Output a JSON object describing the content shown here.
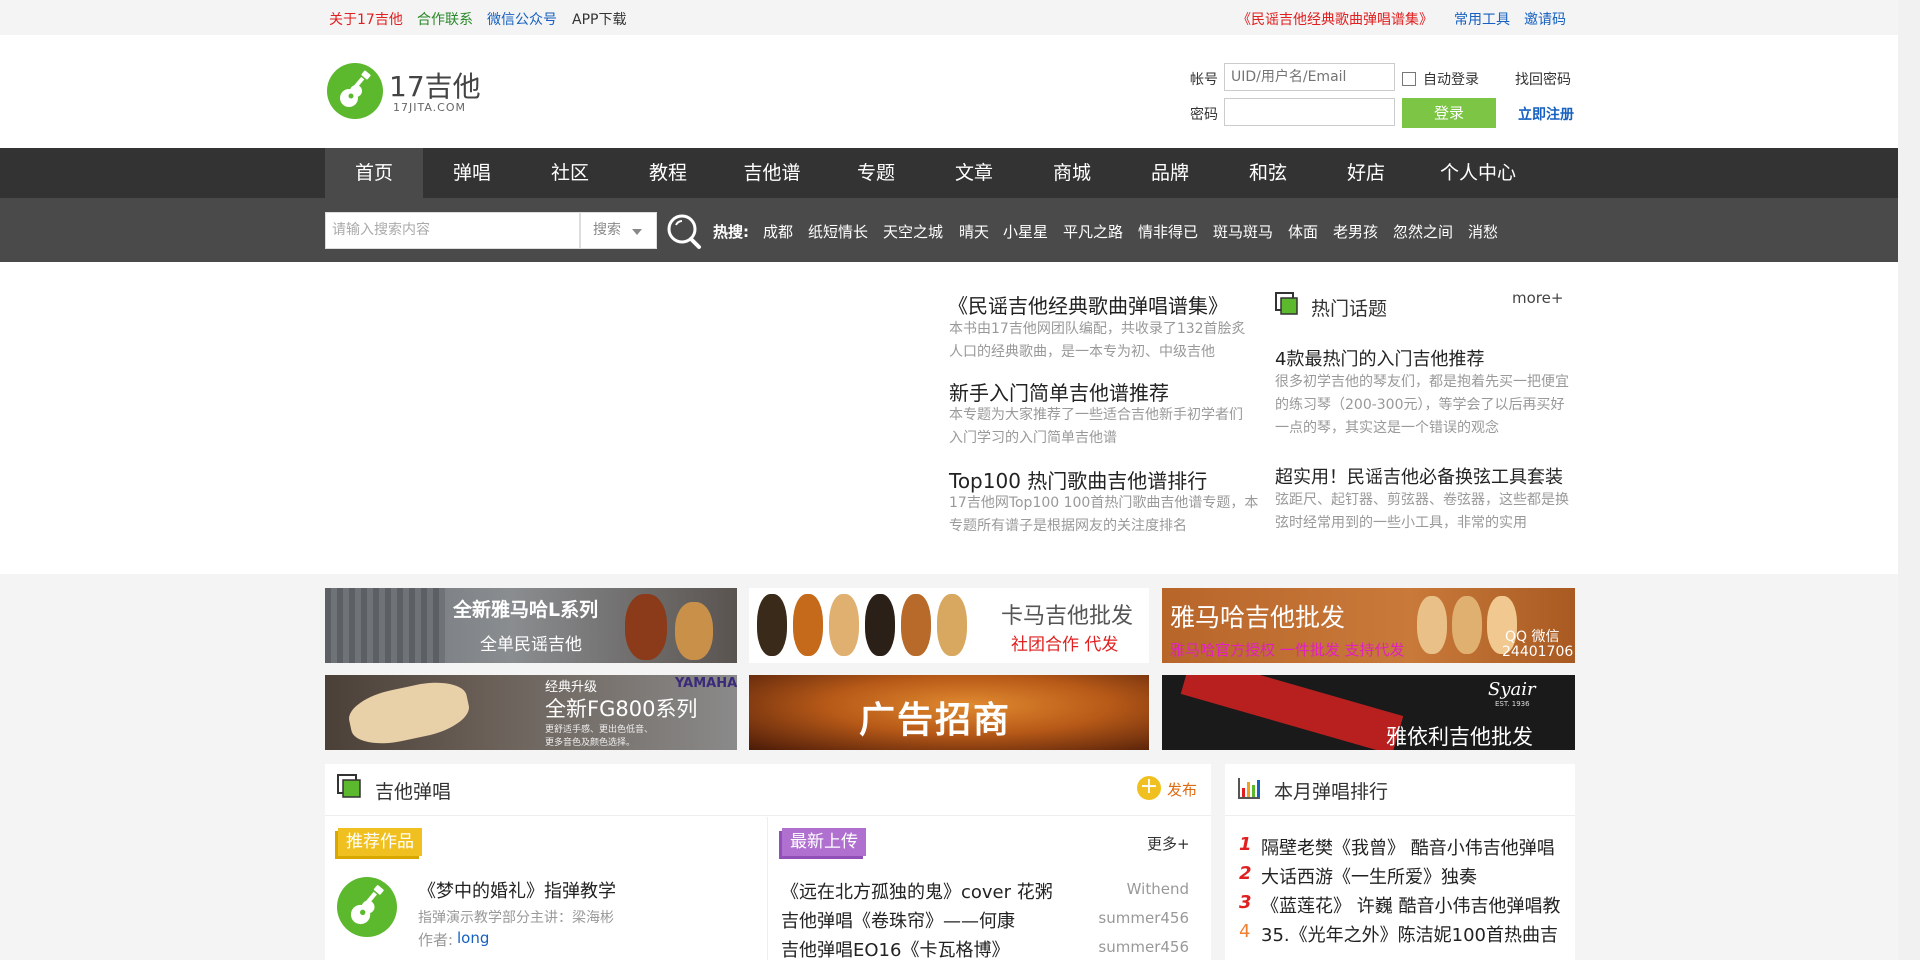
{
  "topbar": {
    "about": "关于17吉他",
    "contact": "合作联系",
    "wechat": "微信公众号",
    "app": "APP下载",
    "book": "《民谣吉他经典歌曲弹唱谱集》",
    "tools": "常用工具",
    "invite": "邀请码"
  },
  "logo": {
    "name": "17吉他",
    "domain": "17JITA.COM"
  },
  "login": {
    "account_label": "帐号",
    "account_placeholder": "UID/用户名/Email",
    "auto_login": "自动登录",
    "forgot": "找回密码",
    "password_label": "密码",
    "login_button": "登录",
    "register": "立即注册"
  },
  "nav": {
    "items": [
      "首页",
      "弹唱",
      "社区",
      "教程",
      "吉他谱",
      "专题",
      "文章",
      "商城",
      "品牌",
      "和弦",
      "好店",
      "个人中心"
    ]
  },
  "search": {
    "placeholder": "请输入搜索内容",
    "select_value": "搜索",
    "hot_label": "热搜:",
    "hot_words": [
      "成都",
      "纸短情长",
      "天空之城",
      "晴天",
      "小星星",
      "平凡之路",
      "情非得已",
      "斑马斑马",
      "体面",
      "老男孩",
      "忽然之间",
      "消愁"
    ]
  },
  "featured": {
    "items": [
      {
        "title": "《民谣吉他经典歌曲弹唱谱集》",
        "desc": "本书由17吉他网团队编配，共收录了132首脍炙人口的经典歌曲，是一本专为初、中级吉他"
      },
      {
        "title": "新手入门简单吉他谱推荐",
        "desc": "本专题为大家推荐了一些适合吉他新手初学者们入门学习的入门简单吉他谱"
      },
      {
        "title": "Top100 热门歌曲吉他谱排行",
        "desc": "17吉他网Top100 100首热门歌曲吉他谱专题，本专题所有谱子是根据网友的关注度排名"
      }
    ]
  },
  "hot_topics": {
    "heading": "热门话题",
    "more": "more+",
    "items": [
      {
        "title": "4款最热门的入门吉他推荐",
        "desc": "很多初学吉他的琴友们，都是抱着先买一把便宜的练习琴（200-300元），等学会了以后再买好一点的琴，其实这是一个错误的观念"
      },
      {
        "title": "超实用！民谣吉他必备换弦工具套装",
        "desc": "弦距尺、起钉器、剪弦器、卷弦器，这些都是换弦时经常用到的一些小工具，非常的实用"
      }
    ]
  },
  "banners": {
    "b1": {
      "line1": "全新雅马哈L系列",
      "line2": "全单民谣吉他"
    },
    "b2": {
      "line1": "卡马吉他批发",
      "line2": "社团合作 代发"
    },
    "b3": {
      "line1": "雅马哈吉他批发",
      "line2": "雅马哈官方授权 一件批发 支持代发",
      "qq": "QQ 微信",
      "number": "24401706"
    },
    "b4": {
      "line1": "经典升级",
      "line2": "全新FG800系列",
      "brand": "YAMAHA",
      "line3": "更舒适手感、更出色低音、",
      "line4": "更多音色及颜色选择。"
    },
    "b5": {
      "text": "广告招商"
    },
    "b6": {
      "text": "雅依利吉他批发",
      "brand": "Syair",
      "est": "EST. 1936"
    }
  },
  "tanchang": {
    "heading": "吉他弹唱",
    "publish": "发布",
    "recommend_tag": "推荐作品",
    "recommend": {
      "title": "《梦中的婚礼》指弹教学",
      "desc": "指弹演示教学部分主讲：梁海彬",
      "author_label": "作者:",
      "author": "long"
    },
    "latest_tag": "最新上传",
    "more": "更多+",
    "latest": [
      {
        "title": "《远在北方孤独的鬼》cover 花粥",
        "user": "Withend"
      },
      {
        "title": "吉他弹唱《卷珠帘》——何康",
        "user": "summer456"
      },
      {
        "title": "吉他弹唱EO16《卡瓦格博》",
        "user": "summer456"
      }
    ]
  },
  "ranking": {
    "heading": "本月弹唱排行",
    "items": [
      {
        "num": "1",
        "title": "隔壁老樊《我曾》 酷音小伟吉他弹唱"
      },
      {
        "num": "2",
        "title": "大话西游《一生所爱》独奏"
      },
      {
        "num": "3",
        "title": "《蓝莲花》 许巍 酷音小伟吉他弹唱教"
      },
      {
        "num": "4",
        "title": "35.《光年之外》陈洁妮100首热曲吉"
      }
    ]
  },
  "colors": {
    "brand_green": "#5cb82d",
    "login_green": "#7cc545",
    "rank_red": "#e02020",
    "rank_orange": "#f08030",
    "link_blue": "#1560c0"
  }
}
